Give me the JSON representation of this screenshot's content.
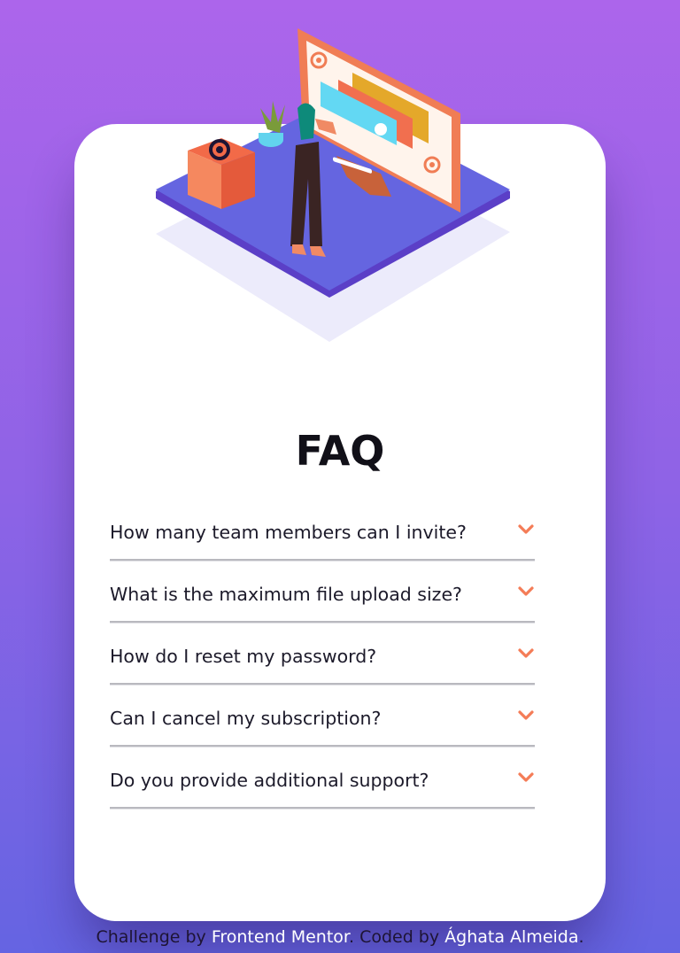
{
  "faq": {
    "title": "FAQ",
    "chevron_icon": "chevron-down-icon",
    "accent_color": "#f47c57",
    "items": [
      {
        "question": "How many team members can I invite?"
      },
      {
        "question": "What is the maximum file upload size?"
      },
      {
        "question": "How do I reset my password?"
      },
      {
        "question": "Can I cancel my subscription?"
      },
      {
        "question": "Do you provide additional support?"
      }
    ]
  },
  "illustration": {
    "icon": "woman-online-illustration"
  },
  "footer": {
    "prefix": "Challenge by ",
    "link1": "Frontend Mentor",
    "middle": ". Coded by ",
    "link2": "Ághata Almeida",
    "suffix": "."
  },
  "colors": {
    "background_top": "#ac65eb",
    "background_bottom": "#6564e2",
    "card": "#ffffff",
    "divider": "#b9b9bf"
  }
}
